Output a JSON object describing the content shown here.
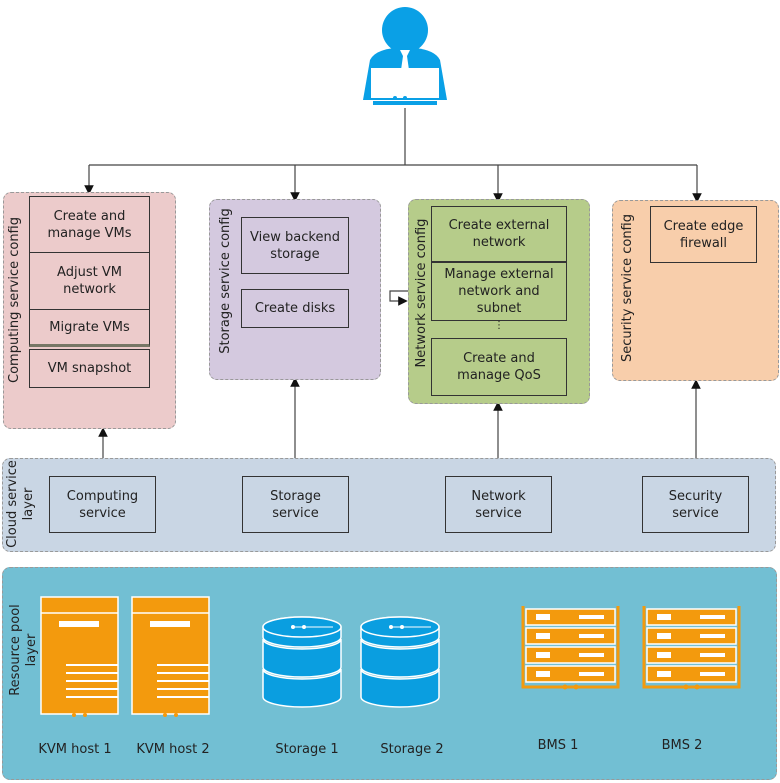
{
  "user_icon": "user-with-laptop-icon",
  "colors": {
    "computing": "#eccbcb",
    "storage": "#d4c9df",
    "network": "#b6cc8a",
    "security": "#f8ceab",
    "cloud_layer": "#c9d6e4",
    "resource_layer": "#72bfd3",
    "user_blue": "#0aa0e6",
    "server_orange": "#f39a0d",
    "disk_blue": "#0a9ee0"
  },
  "config_panels": {
    "computing": {
      "title": "Computing service config",
      "items": [
        "Create and manage VMs",
        "Adjust VM network",
        "Migrate VMs",
        "VM snapshot"
      ]
    },
    "storage": {
      "title": "Storage service config",
      "items": [
        "View backend storage",
        "Create disks"
      ]
    },
    "network": {
      "title": "Network service config",
      "items": [
        "Create external network",
        "Manage external network and subnet",
        "Create and manage QoS"
      ],
      "ellipsis": "⋮"
    },
    "security": {
      "title": "Security service config",
      "items": [
        "Create edge firewall"
      ]
    }
  },
  "cloud_layer": {
    "title_line1": "Cloud service",
    "title_line2": "layer",
    "services": [
      "Computing service",
      "Storage service",
      "Network service",
      "Security service"
    ]
  },
  "resource_layer": {
    "title_line1": "Resource pool",
    "title_line2": "layer",
    "resources": [
      {
        "label": "KVM host 1",
        "icon": "kvm-host-icon"
      },
      {
        "label": "KVM host 2",
        "icon": "kvm-host-icon"
      },
      {
        "label": "Storage 1",
        "icon": "storage-disk-icon"
      },
      {
        "label": "Storage 2",
        "icon": "storage-disk-icon"
      },
      {
        "label": "BMS 1",
        "icon": "bare-metal-server-icon"
      },
      {
        "label": "BMS 2",
        "icon": "bare-metal-server-icon"
      }
    ]
  }
}
